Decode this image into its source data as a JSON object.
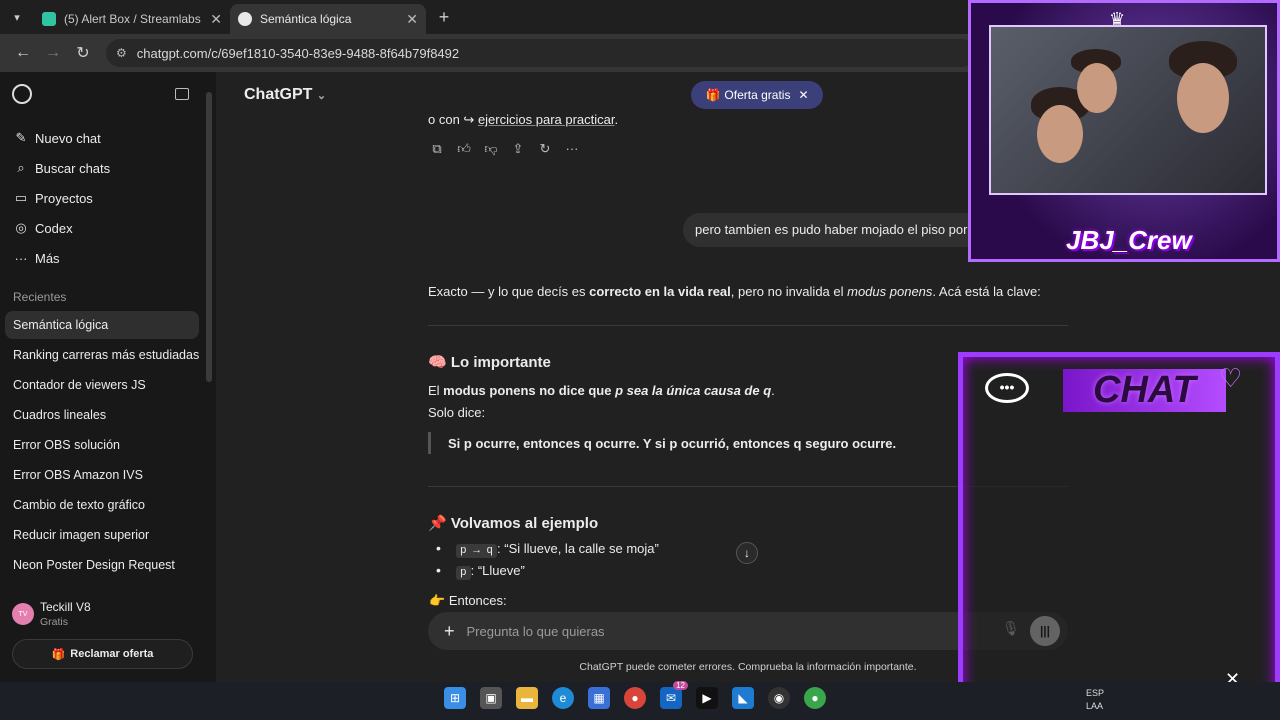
{
  "browser": {
    "tabs": [
      {
        "title": "(5) Alert Box / Streamlabs",
        "favicon_color": "#31c3a2"
      },
      {
        "title": "Semántica lógica",
        "favicon_color": "#e8e8e8"
      }
    ],
    "url": "chatgpt.com/c/69ef1810-3540-83e9-9488-8f64b79f8492"
  },
  "sidebar": {
    "nav": [
      {
        "label": "Nuevo chat",
        "icon": "edit-icon"
      },
      {
        "label": "Buscar chats",
        "icon": "search-icon"
      },
      {
        "label": "Proyectos",
        "icon": "folder-icon"
      },
      {
        "label": "Codex",
        "icon": "codex-icon"
      },
      {
        "label": "Más",
        "icon": "more-icon"
      }
    ],
    "section_label": "Recientes",
    "chats": [
      "Semántica lógica",
      "Ranking carreras más estudiadas",
      "Contador de viewers JS",
      "Cuadros lineales",
      "Error OBS solución",
      "Error OBS Amazon IVS",
      "Cambio de texto gráfico",
      "Reducir imagen superior",
      "Neon Poster Design Request"
    ],
    "user": {
      "initials": "TV",
      "name": "Teckill V8",
      "plan": "Gratis"
    },
    "claim_label": "Reclamar oferta"
  },
  "main": {
    "title": "ChatGPT",
    "offer_label": "Oferta gratis",
    "prev_line_start": "o con ↪",
    "prev_line_link": "ejercicios para practicar",
    "user_message": "pero tambien es pudo haber mojado el piso por otro motivo",
    "answer": {
      "intro_a": "Exacto — y lo que decís es ",
      "intro_b": "correcto en la vida real",
      "intro_c": ", pero no invalida el ",
      "intro_d": "modus ponens",
      "intro_e": ". Acá está la clave:",
      "h1_emoji": "🧠",
      "h1": "Lo importante",
      "p1_a": "El ",
      "p1_b": "modus ponens no dice que ",
      "p1_c": "p sea la única causa de q",
      "p1_d": ".",
      "p2": "Solo dice:",
      "quote": "Si p ocurre, entonces q ocurre. Y si p ocurrió, entonces q seguro ocurre.",
      "h2_emoji": "📌",
      "h2": "Volvamos al ejemplo",
      "bullet1_code": "p → q",
      "bullet1_text": ": “Si llueve, la calle se moja”",
      "bullet2_code": "p",
      "bullet2_text": ": “Llueve”",
      "then_emoji": "👉",
      "then_text": "Entonces:"
    },
    "composer_placeholder": "Pregunta lo que quieras",
    "disclaimer": "ChatGPT puede cometer errores. Comprueba la información importante."
  },
  "overlay": {
    "crew_label": "JBJ_Crew",
    "chat_title": "CHAT"
  },
  "taskbar": {
    "badge_count": "12",
    "lang_line1": "ESP",
    "lang_line2": "LAA"
  }
}
